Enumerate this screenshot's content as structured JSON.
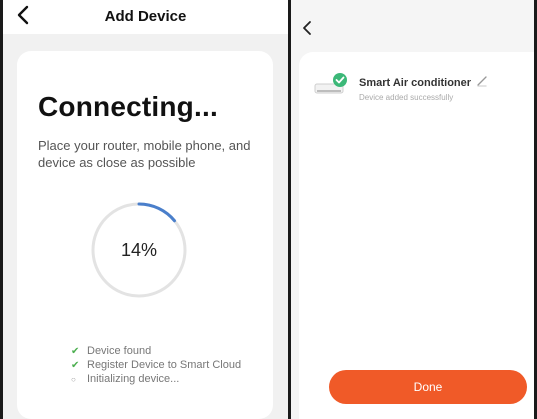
{
  "left_screen": {
    "header": {
      "title": "Add Device",
      "back_icon": "chevron-left-icon"
    },
    "card": {
      "title": "Connecting...",
      "instruction": "Place your router, mobile phone, and device as close as possible",
      "progress": {
        "percent": 14,
        "label": "14%"
      },
      "steps": [
        {
          "label": "Device found",
          "state": "done"
        },
        {
          "label": "Register Device to Smart Cloud",
          "state": "done"
        },
        {
          "label": "Initializing device...",
          "state": "pending"
        }
      ]
    }
  },
  "right_screen": {
    "back_icon": "chevron-left-icon",
    "device": {
      "name": "Smart Air conditioner",
      "status": "Device added successfully",
      "icon": "air-conditioner-icon"
    },
    "done_button": {
      "label": "Done"
    }
  },
  "colors": {
    "accent_blue": "#4a7fcb",
    "success_green": "#4caf50",
    "done_orange": "#f05a28",
    "ring_track": "#e3e3e3"
  }
}
